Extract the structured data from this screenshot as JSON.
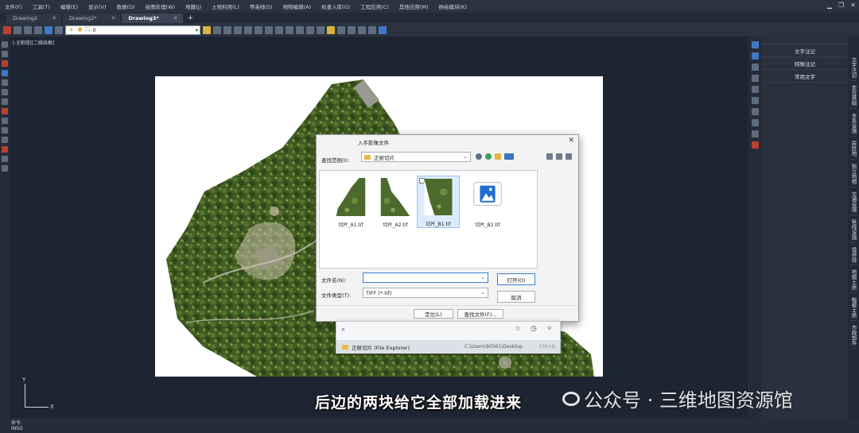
{
  "menu": [
    "文件(F)",
    "工具(T)",
    "编辑(E)",
    "显示(V)",
    "数据(D)",
    "绘图处理(W)",
    "地籍(J)",
    "土地利用(L)",
    "等高线(S)",
    "地物编辑(A)",
    "检查入库(G)",
    "工程应用(C)",
    "其他应用(M)",
    "扬绘模块(K)"
  ],
  "tabs": [
    {
      "label": "Drawing2",
      "close": "✕"
    },
    {
      "label": "Drawing2*",
      "close": "✕"
    },
    {
      "label": "Drawing3*",
      "close": "✕"
    }
  ],
  "tab_add": "+",
  "toolbar": {
    "layer_value": "0"
  },
  "view_label": "[-][俯视][二维线框]",
  "right_panel": {
    "items": [
      "文字注记",
      "特殊注记",
      "常用文字"
    ]
  },
  "vertical_tabs": [
    "文字注记",
    "定位基础",
    "水系设施",
    "居民地",
    "独立地物",
    "交通设施",
    "管线设施",
    "境界线",
    "地貌土质",
    "植被土质",
    "市政部件"
  ],
  "dialog": {
    "title": "入手影像文件",
    "close": "✕",
    "lookin_label": "查找范围(I):",
    "lookin_value": "正射切片",
    "files": [
      {
        "name": "切片_A1.tif"
      },
      {
        "name": "切片_A2.tif"
      },
      {
        "name": "切片_B1.tif"
      },
      {
        "name": "切片_B2.tif"
      }
    ],
    "filename_label": "文件名(N):",
    "filename_value": "",
    "filetype_label": "文件类型(T):",
    "filetype_value": "TIFF (*.tif)",
    "open_button": "打开(O)",
    "cancel_button": "取消",
    "locate_button": "定位(L)",
    "find_button": "查找文件(F)..."
  },
  "launcher": {
    "result_label": "正射切片 (File Explorer)",
    "result_path": "C:\\Users\\90561\\Desktop",
    "shortcut": "Ctrl+G"
  },
  "command": {
    "prompt": "命令:",
    "mode": "INSG"
  },
  "ucs": {
    "x": "X",
    "y": "Y"
  },
  "subtitle": "后边的两块给它全部加载进来",
  "watermark": "公众号 · 三维地图资源馆",
  "colors": {
    "background": "#1f2733",
    "panel": "#2a313d",
    "dialog": "#f3f3f3",
    "accent": "#3c7fd5"
  }
}
